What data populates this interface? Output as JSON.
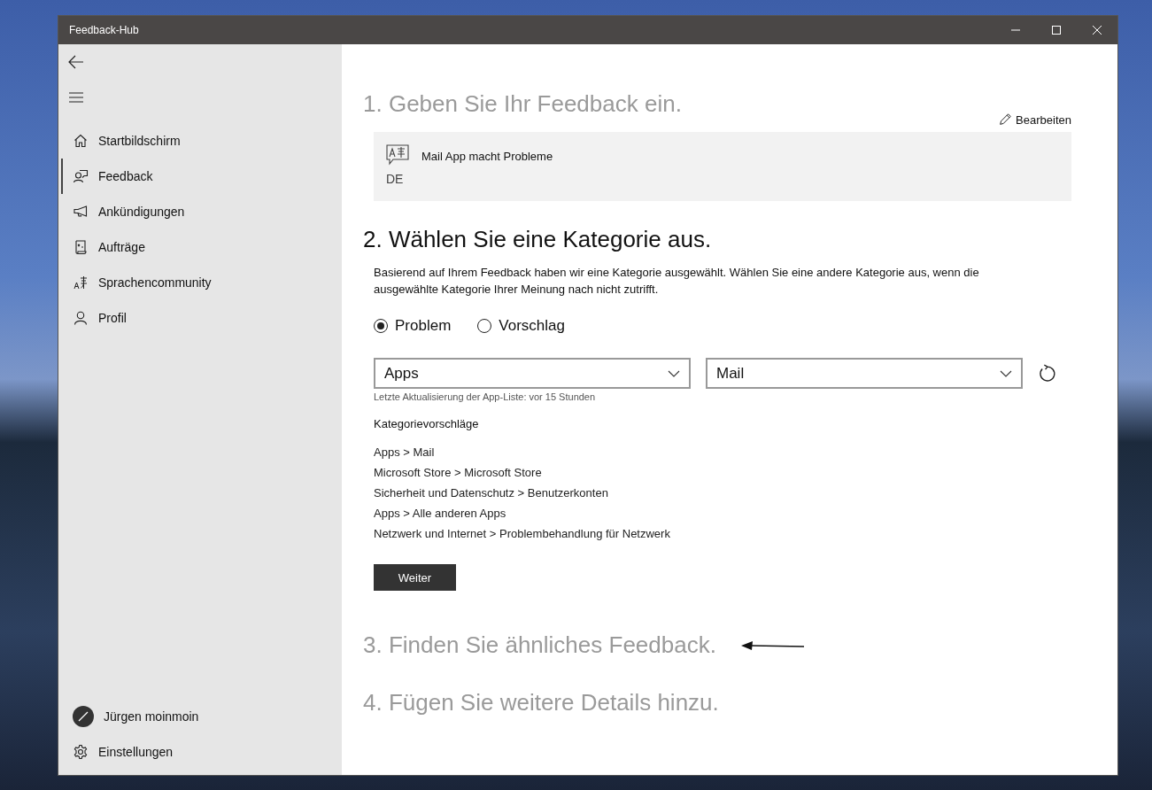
{
  "window": {
    "title": "Feedback-Hub"
  },
  "sidebar": {
    "items": [
      {
        "label": "Startbildschirm",
        "selected": false
      },
      {
        "label": "Feedback",
        "selected": true
      },
      {
        "label": "Ankündigungen",
        "selected": false
      },
      {
        "label": "Aufträge",
        "selected": false
      },
      {
        "label": "Sprachencommunity",
        "selected": false
      },
      {
        "label": "Profil",
        "selected": false
      }
    ],
    "user": {
      "name": "Jürgen moinmoin"
    },
    "settings": {
      "label": "Einstellungen"
    }
  },
  "steps": [
    {
      "kind": "entered",
      "title": "1. Geben Sie Ihr Feedback ein.",
      "active": false,
      "edit_link": "Bearbeiten",
      "feedback": {
        "text": "Mail App macht Probleme",
        "language": "DE"
      }
    },
    {
      "kind": "category",
      "title": "2. Wählen Sie eine Kategorie aus.",
      "active": true,
      "description": "Basierend auf Ihrem Feedback haben wir eine Kategorie ausgewählt. Wählen Sie eine andere Kategorie aus, wenn die ausgewählte Kategorie Ihrer Meinung nach nicht zutrifft.",
      "radios": [
        {
          "label": "Problem",
          "selected": true
        },
        {
          "label": "Vorschlag",
          "selected": false
        }
      ],
      "dropdowns": [
        {
          "value": "Apps"
        },
        {
          "value": "Mail"
        }
      ],
      "update_note": "Letzte Aktualisierung der App-Liste: vor 15 Stunden",
      "suggestions_heading": "Kategorievorschläge",
      "suggestions": [
        "Apps > Mail",
        "Microsoft Store > Microsoft Store",
        "Sicherheit und Datenschutz > Benutzerkonten",
        "Apps > Alle anderen Apps",
        "Netzwerk und Internet > Problembehandlung für Netzwerk"
      ],
      "button": "Weiter"
    },
    {
      "kind": "pending",
      "title": "3. Finden Sie ähnliches Feedback.",
      "active": false,
      "arrow_marker": true
    },
    {
      "kind": "pending",
      "title": "4. Fügen Sie weitere Details hinzu.",
      "active": false,
      "arrow_marker": false
    }
  ]
}
